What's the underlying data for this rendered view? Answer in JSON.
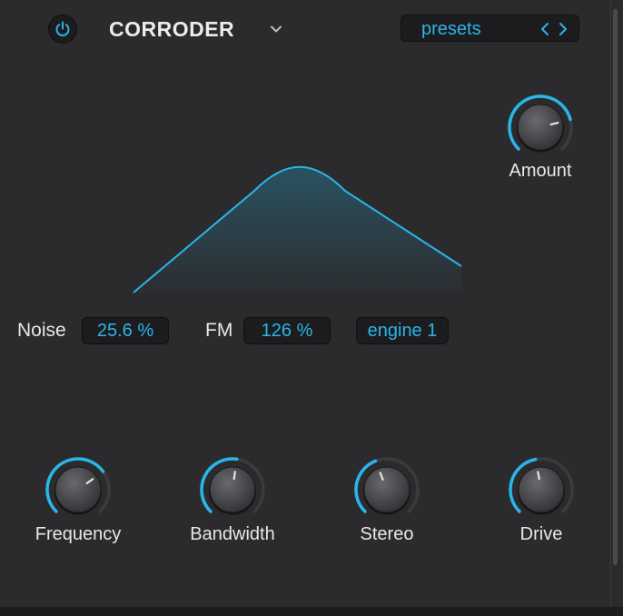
{
  "header": {
    "title": "CORRODER",
    "presets_label": "presets"
  },
  "amount": {
    "label": "Amount",
    "value": 0.78
  },
  "params": {
    "noise_label": "Noise",
    "noise_value": "25.6 %",
    "fm_label": "FM",
    "fm_value": "126 %",
    "engine_value": "engine 1"
  },
  "knobs": [
    {
      "label": "Frequency",
      "value": 0.7
    },
    {
      "label": "Bandwidth",
      "value": 0.53
    },
    {
      "label": "Stereo",
      "value": 0.42
    },
    {
      "label": "Drive",
      "value": 0.46
    }
  ],
  "colors": {
    "accent": "#29b6e8",
    "panel": "#2b2b2d",
    "field": "#1c1c1e",
    "track": "#3b3b3e"
  },
  "icons": {
    "power": "power-icon",
    "dropdown": "chevron-down-icon",
    "prev": "chevron-left-icon",
    "next": "chevron-right-icon"
  }
}
